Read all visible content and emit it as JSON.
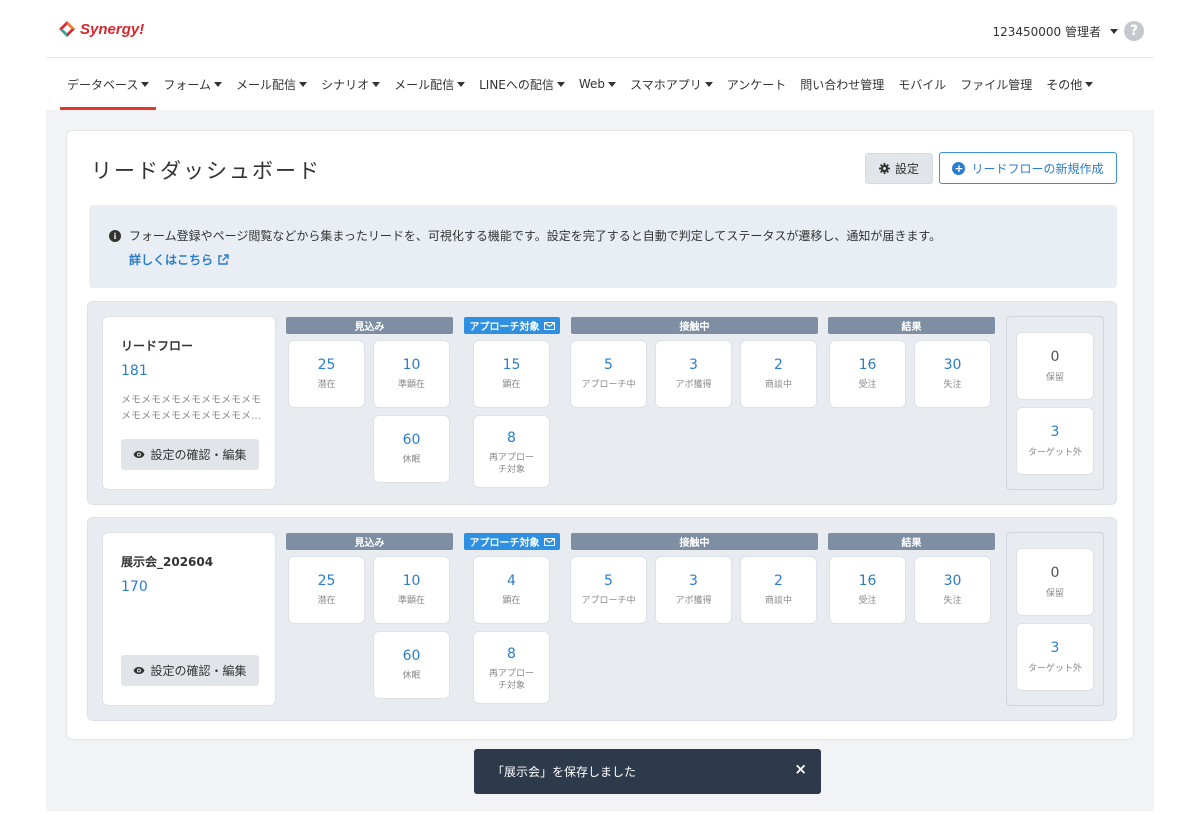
{
  "header": {
    "logo_text": "Synergy!",
    "account_label": "123450000 管理者",
    "help_label": "?"
  },
  "nav": {
    "items": [
      {
        "label": "データベース",
        "dropdown": true,
        "active": true
      },
      {
        "label": "フォーム",
        "dropdown": true
      },
      {
        "label": "メール配信",
        "dropdown": true
      },
      {
        "label": "シナリオ",
        "dropdown": true
      },
      {
        "label": "メール配信",
        "dropdown": true
      },
      {
        "label": "LINEへの配信",
        "dropdown": true
      },
      {
        "label": "Web",
        "dropdown": true
      },
      {
        "label": "スマホアプリ",
        "dropdown": true
      },
      {
        "label": "アンケート",
        "dropdown": false
      },
      {
        "label": "問い合わせ管理",
        "dropdown": false
      },
      {
        "label": "モバイル",
        "dropdown": false
      },
      {
        "label": "ファイル管理",
        "dropdown": false
      },
      {
        "label": "その他",
        "dropdown": true
      }
    ]
  },
  "main": {
    "title": "リードダッシュボード",
    "settings_button": "設定",
    "new_flow_button": "リードフローの新規作成",
    "info_text": "フォーム登録やページ閲覧などから集まったリードを、可視化する機能です。設定を完了すると自動で判定してステータスが遷移し、通知が届きます。",
    "info_link": "詳しくはこちら"
  },
  "groups": {
    "prospect": "見込み",
    "approach": "アプローチ対象",
    "contact": "接触中",
    "result": "結果"
  },
  "flows": [
    {
      "name": "リードフロー",
      "count": "181",
      "memo_lines": [
        "メモメモメモメモメモメモメモ",
        "メモメモメモメモメモメモメモメモ…"
      ],
      "edit_button": "設定の確認・編集",
      "cells": {
        "latent": {
          "num": "25",
          "label": "潜在"
        },
        "semi": {
          "num": "10",
          "label": "準顕在"
        },
        "dormant": {
          "num": "60",
          "label": "休眠"
        },
        "apparent": {
          "num": "15",
          "label": "顕在"
        },
        "reapproach": {
          "num": "8",
          "label": "再アプローチ対象"
        },
        "approaching": {
          "num": "5",
          "label": "アプローチ中"
        },
        "appointment": {
          "num": "3",
          "label": "アポ獲得"
        },
        "negotiating": {
          "num": "2",
          "label": "商談中"
        },
        "won": {
          "num": "16",
          "label": "受注"
        },
        "lost": {
          "num": "30",
          "label": "失注"
        },
        "hold": {
          "num": "0",
          "label": "保留"
        },
        "excluded": {
          "num": "3",
          "label": "ターゲット外"
        }
      }
    },
    {
      "name": "展示会_202604",
      "count": "170",
      "memo_lines": [],
      "edit_button": "設定の確認・編集",
      "cells": {
        "latent": {
          "num": "25",
          "label": "潜在"
        },
        "semi": {
          "num": "10",
          "label": "準顕在"
        },
        "dormant": {
          "num": "60",
          "label": "休眠"
        },
        "apparent": {
          "num": "4",
          "label": "顕在"
        },
        "reapproach": {
          "num": "8",
          "label": "再アプローチ対象"
        },
        "approaching": {
          "num": "5",
          "label": "アプローチ中"
        },
        "appointment": {
          "num": "3",
          "label": "アポ獲得"
        },
        "negotiating": {
          "num": "2",
          "label": "商談中"
        },
        "won": {
          "num": "16",
          "label": "受注"
        },
        "lost": {
          "num": "30",
          "label": "失注"
        },
        "hold": {
          "num": "0",
          "label": "保留"
        },
        "excluded": {
          "num": "3",
          "label": "ターゲット外"
        }
      }
    }
  ],
  "toast": {
    "message": "「展示会」を保存しました",
    "close_label": "×"
  },
  "colors": {
    "accent": "#2a7dcb",
    "brand": "#d8262e",
    "group_header": "#7e8fa4",
    "approach_header": "#2f8fe0",
    "toast_bg": "#2c3a4b"
  }
}
